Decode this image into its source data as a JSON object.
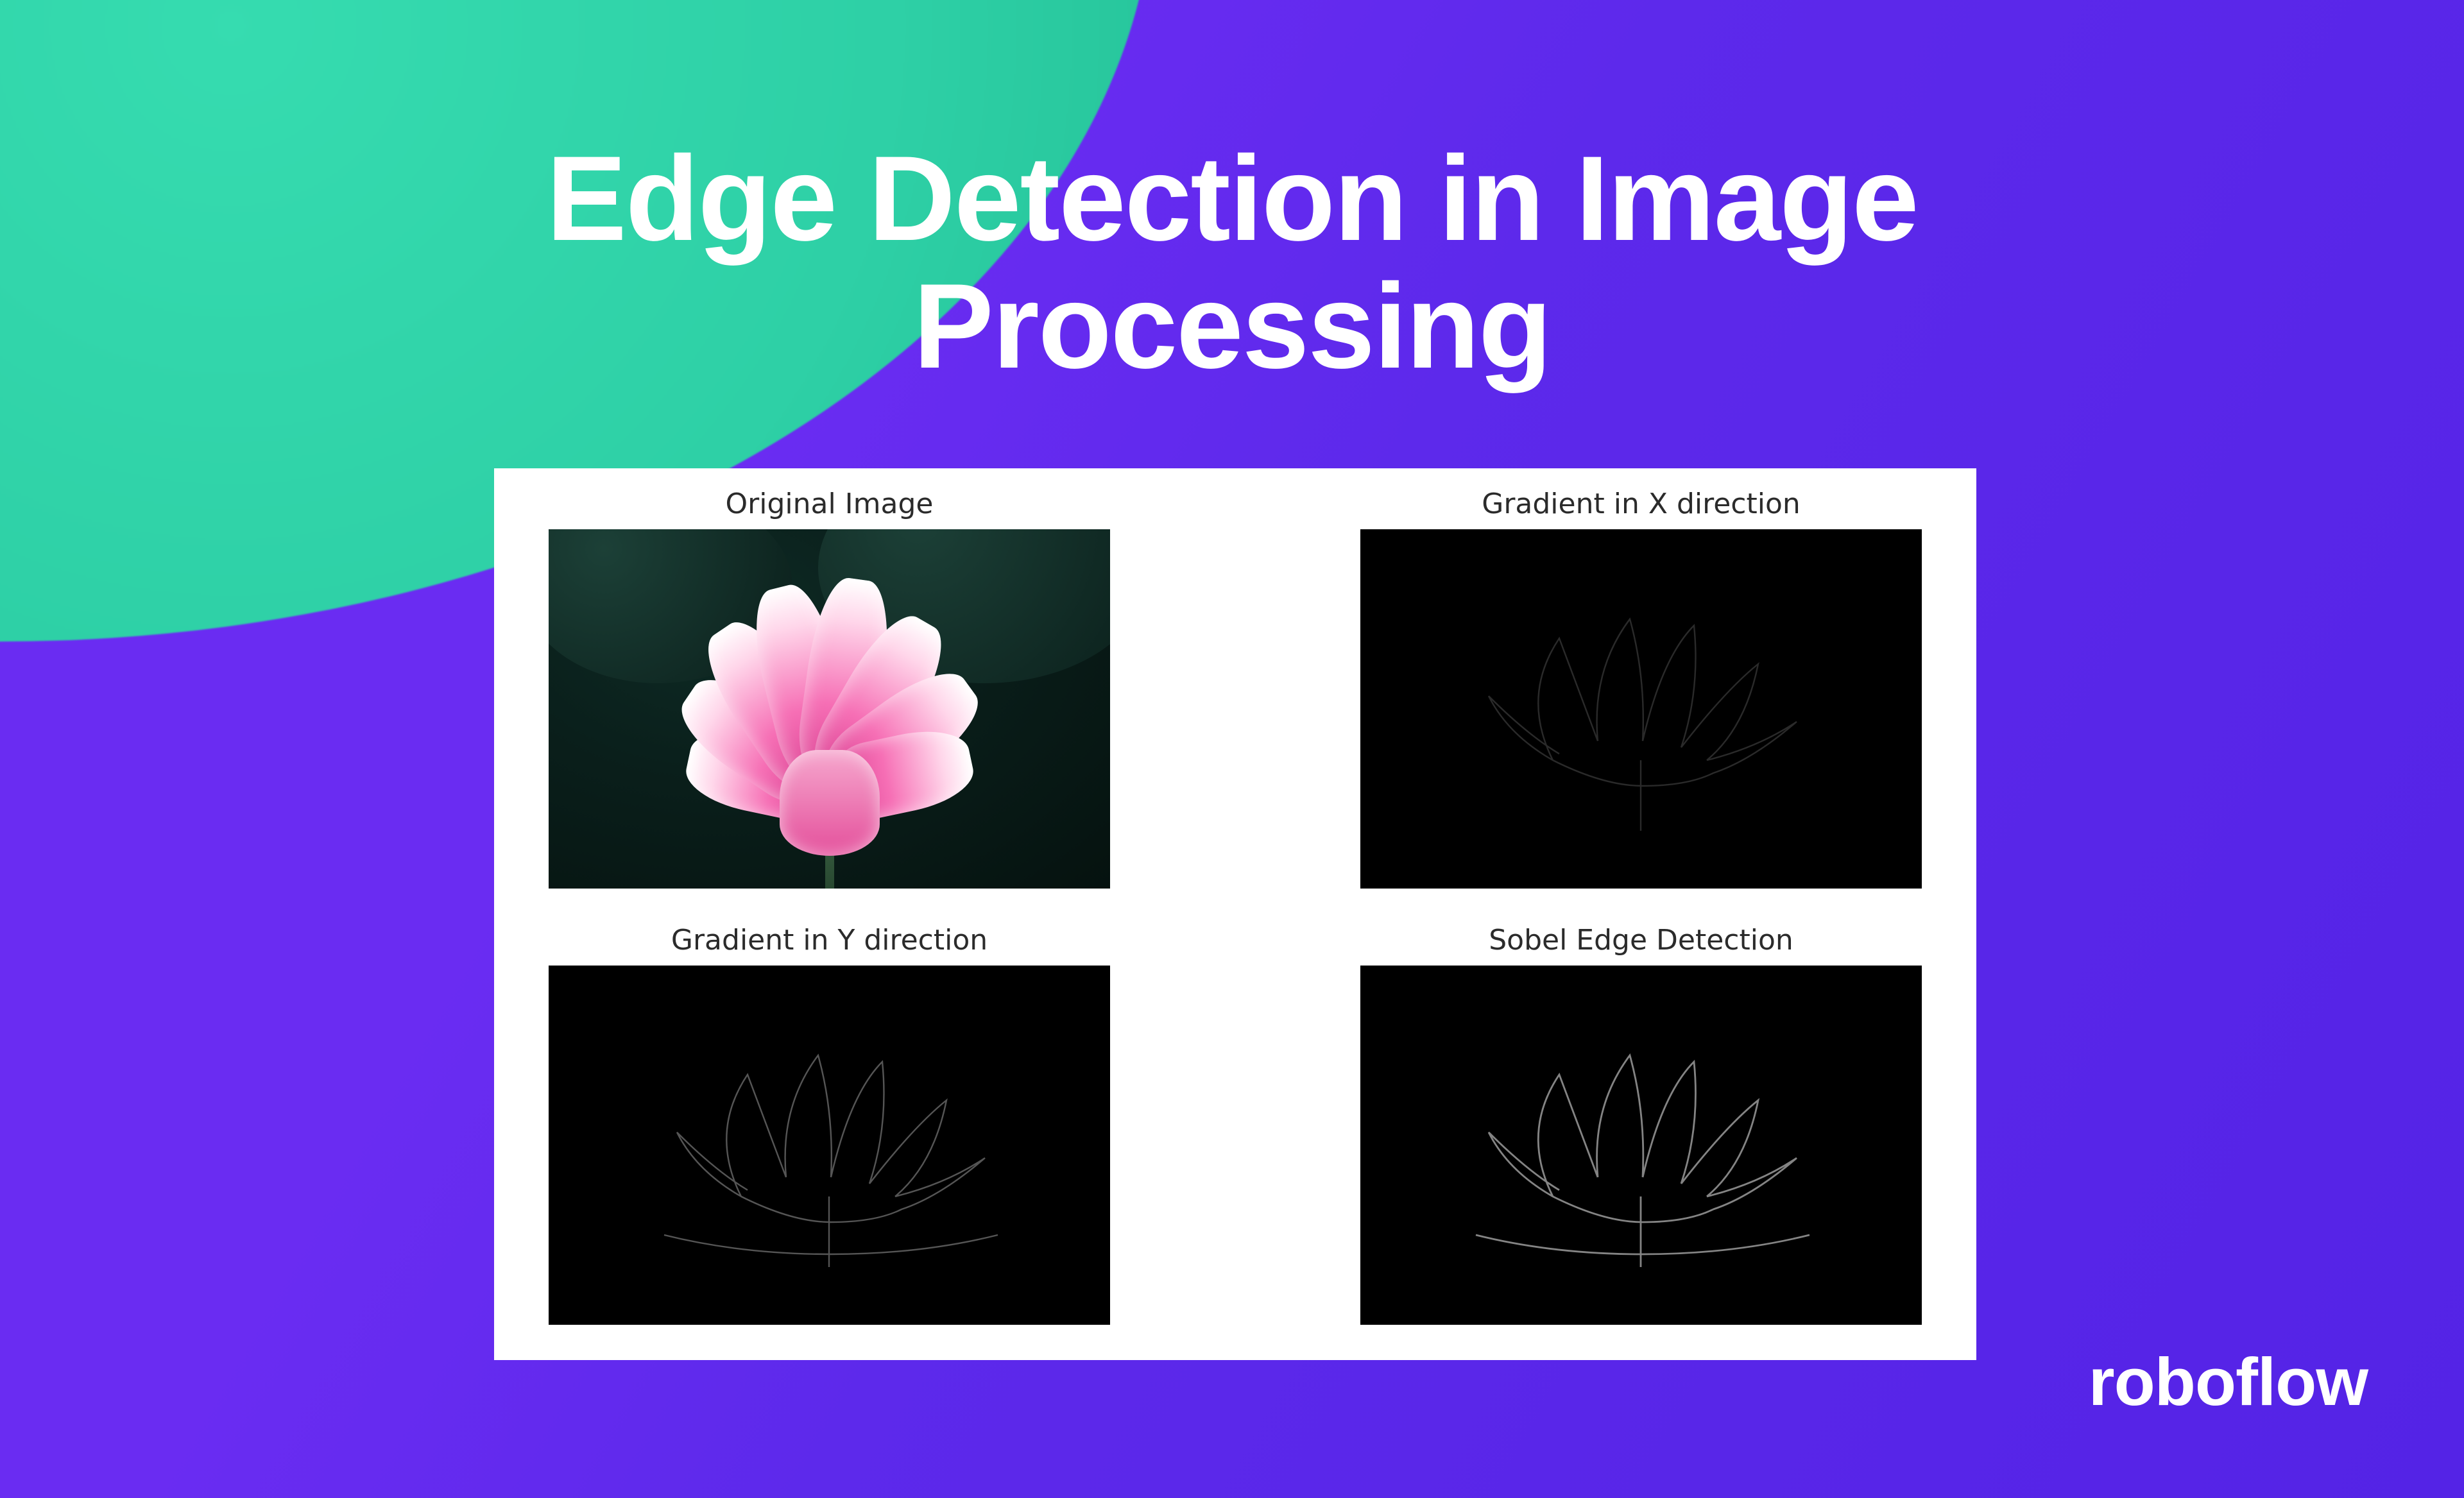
{
  "title": "Edge Detection in Image\nProcessing",
  "panel": {
    "cells": [
      {
        "label": "Original Image"
      },
      {
        "label": "Gradient in X direction"
      },
      {
        "label": "Gradient in Y direction"
      },
      {
        "label": "Sobel Edge Detection"
      }
    ]
  },
  "watermark": "roboflow",
  "colors": {
    "bg_purple": "#5d29eb",
    "bg_teal": "#2ed0a6",
    "white": "#ffffff"
  }
}
